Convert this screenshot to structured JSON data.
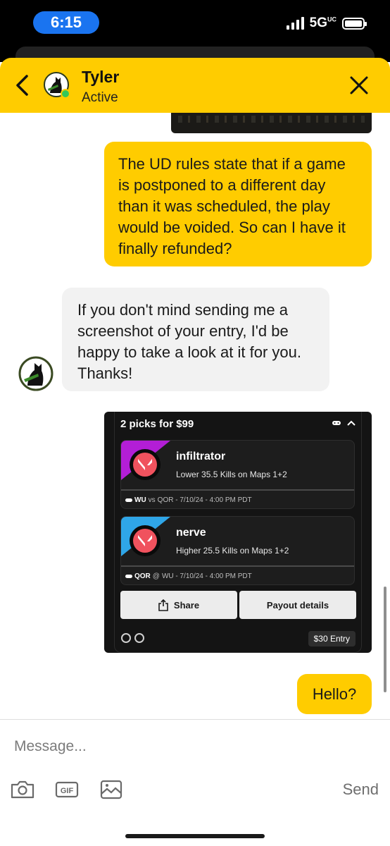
{
  "status_bar": {
    "time": "6:15",
    "network": "5G",
    "network_superscript": "UC"
  },
  "header": {
    "name": "Tyler",
    "status": "Active",
    "back_icon": "chevron-left-icon",
    "close_icon": "close-icon"
  },
  "messages": [
    {
      "direction": "outgoing",
      "text": "The UD rules state that if a game is postponed to a different day than it was scheduled, the play would be voided. So can I have it finally refunded?"
    },
    {
      "direction": "incoming",
      "text": "If you don't mind sending me a screenshot of your entry, I'd be happy to take a look at it for you. Thanks!"
    },
    {
      "direction": "outgoing",
      "text": "Hello?"
    }
  ],
  "entry": {
    "title": "2 picks for $99",
    "picks": [
      {
        "player": "infiltrator",
        "line": "Lower 35.5 Kills on Maps 1+2",
        "team": "WU",
        "sep": "vs",
        "matchup": "QOR - 7/10/24 - 4:00 PM PDT",
        "accent": "#b31ed6"
      },
      {
        "player": "nerve",
        "line": "Higher 25.5 Kills on Maps 1+2",
        "team": "QOR",
        "sep": "@",
        "matchup": "WU - 7/10/24 - 4:00 PM PDT",
        "accent": "#2fa6e8"
      }
    ],
    "share_label": "Share",
    "payout_label": "Payout details",
    "fee_label": "$30 Entry"
  },
  "composer": {
    "placeholder": "Message...",
    "gif_label": "GIF",
    "send_label": "Send"
  },
  "colors": {
    "brand_yellow": "#ffcc00",
    "bubble_incoming": "#f2f2f2",
    "time_pill": "#1a74f0",
    "active_dot": "#35c759"
  }
}
